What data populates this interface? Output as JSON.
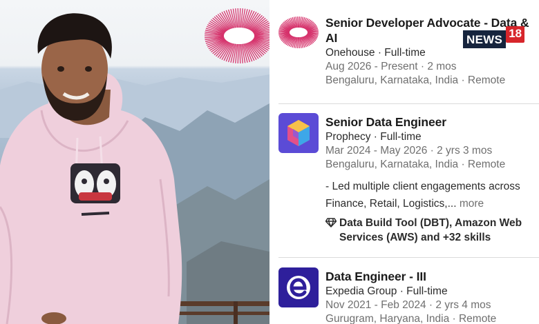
{
  "panel": {
    "experiences": [
      {
        "title": "Senior Developer Advocate - Data & AI",
        "company_line": "Onehouse · Full-time",
        "dates": "Aug 2026 - Present · 2 mos",
        "location": "Bengaluru, Karnataka, India · Remote",
        "logo_icon": "onehouse-sunburst-icon"
      },
      {
        "title": "Senior Data Engineer",
        "company_line": "Prophecy · Full-time",
        "dates": "Mar 2024 - May 2026 · 2 yrs 3 mos",
        "location": "Bengaluru, Karnataka, India · Remote",
        "description": "- Led multiple client engagements across Finance, Retail, Logistics,...",
        "more_label": "more",
        "skills": "Data Build Tool (DBT), Amazon Web Services (AWS) and +32 skills",
        "logo_icon": "prophecy-cube-icon"
      },
      {
        "title": "Data Engineer - III",
        "company_line": "Expedia Group · Full-time",
        "dates": "Nov 2021 - Feb 2024 · 2 yrs 4 mos",
        "location": "Gurugram, Haryana, India · Remote",
        "logo_icon": "expedia-e-icon"
      }
    ]
  },
  "watermark": {
    "word": "NEWS",
    "number": "18"
  },
  "colors": {
    "title": "#1b1b1b",
    "secondary": "#6f6f6f",
    "divider": "#dadada",
    "sunburst": "#d6336c",
    "prophecy_bg": "#5b4bd6",
    "expedia_bg": "#2e1f9b",
    "news18_red": "#d7262b",
    "news18_navy": "#16243d",
    "hoodie": "#efcfdc"
  }
}
